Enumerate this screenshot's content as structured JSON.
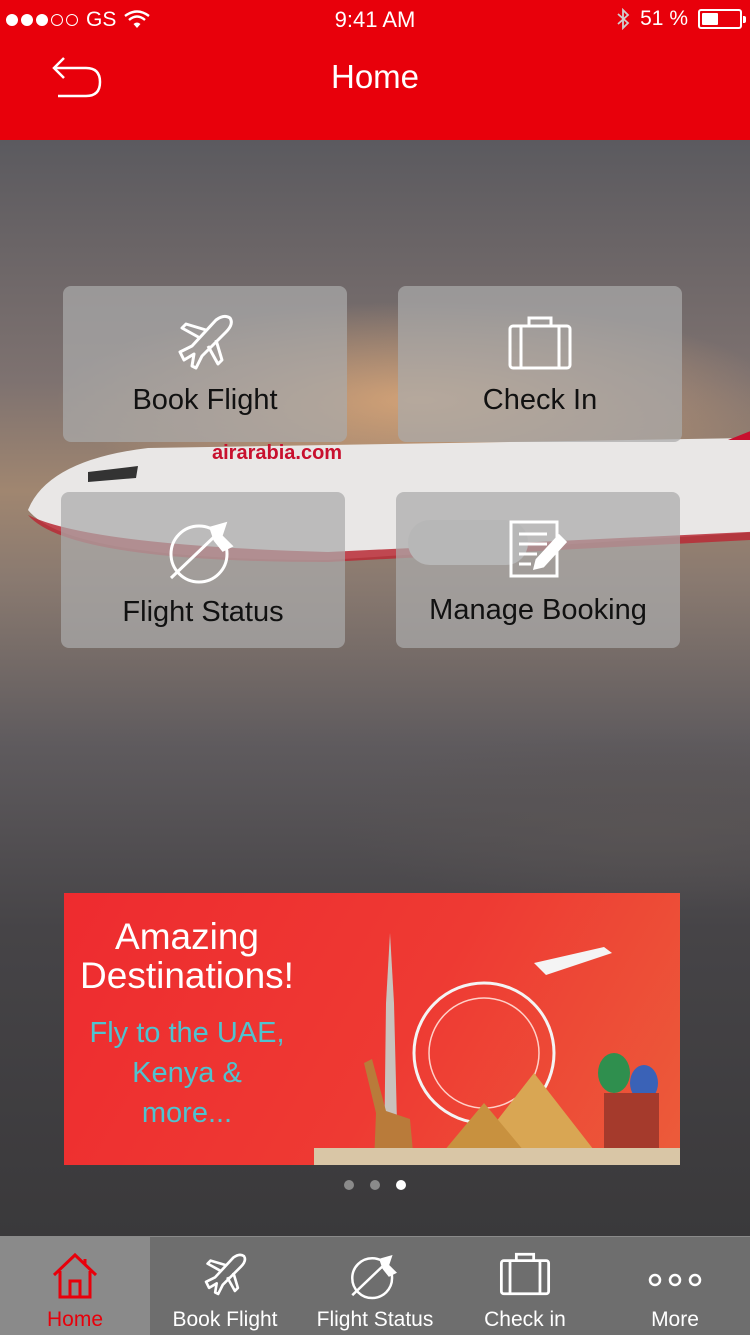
{
  "status_bar": {
    "carrier": "GS",
    "time": "9:41 AM",
    "battery": "51 %",
    "signal_icon": "signal-dots-icon",
    "wifi_icon": "wifi-icon",
    "bluetooth_icon": "bluetooth-icon",
    "battery_level": 0.51
  },
  "header": {
    "title": "Home",
    "back_icon": "back-arrow-icon"
  },
  "hero": {
    "brand_text": "airarabia.com"
  },
  "tiles": [
    {
      "label": "Book Flight",
      "icon": "airplane-icon"
    },
    {
      "label": "Check In",
      "icon": "suitcase-icon"
    },
    {
      "label": "Flight Status",
      "icon": "globe-plane-icon"
    },
    {
      "label": "Manage Booking",
      "icon": "document-edit-icon"
    }
  ],
  "promo": {
    "title_line1": "Amazing",
    "title_line2": "Destinations!",
    "sub_line1": "Fly to the UAE,",
    "sub_line2": "Kenya &",
    "sub_line3": "more...",
    "accent_color": "#4fc3cf"
  },
  "pager": {
    "count": 3,
    "active_index": 2
  },
  "tabbar": {
    "items": [
      {
        "label": "Home",
        "icon": "house-icon",
        "active": true
      },
      {
        "label": "Book Flight",
        "icon": "airplane-icon",
        "active": false
      },
      {
        "label": "Flight Status",
        "icon": "globe-plane-icon",
        "active": false
      },
      {
        "label": "Check in",
        "icon": "suitcase-icon",
        "active": false
      },
      {
        "label": "More",
        "icon": "more-dots-icon",
        "active": false
      }
    ]
  },
  "colors": {
    "brand_red": "#e8000b",
    "tab_bar": "#6e6e6e",
    "tile_bg": "#aaaaaa"
  }
}
